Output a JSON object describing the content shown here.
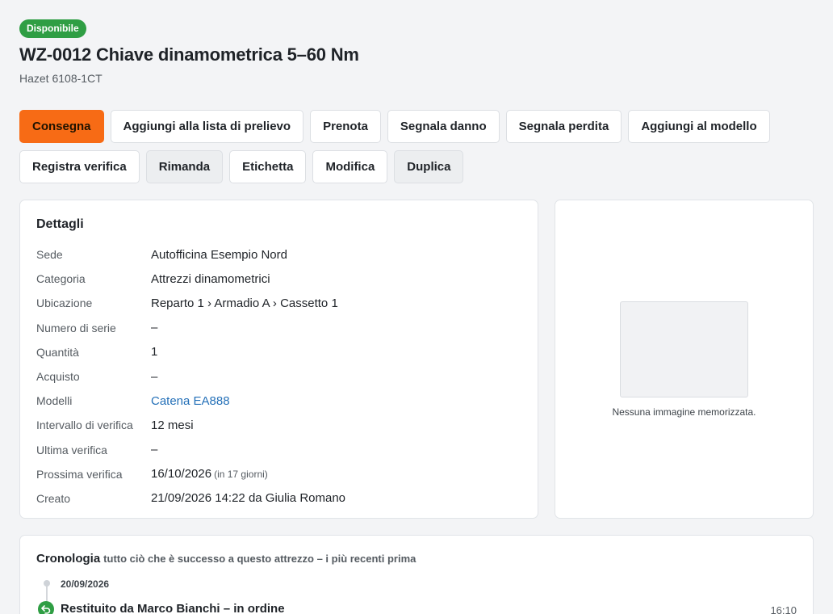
{
  "header": {
    "status_badge": "Disponibile",
    "title": "WZ-0012 Chiave dinamometrica 5–60 Nm",
    "subtitle": "Hazet 6108-1CT"
  },
  "actions": {
    "row1": [
      {
        "label": "Consegna",
        "style": "primary"
      },
      {
        "label": "Aggiungi alla lista di prelievo",
        "style": "default"
      },
      {
        "label": "Prenota",
        "style": "default"
      },
      {
        "label": "Segnala danno",
        "style": "default"
      },
      {
        "label": "Segnala perdita",
        "style": "default"
      },
      {
        "label": "Aggiungi al modello",
        "style": "default"
      }
    ],
    "row2": [
      {
        "label": "Registra verifica",
        "style": "default"
      },
      {
        "label": "Rimanda",
        "style": "muted"
      },
      {
        "label": "Etichetta",
        "style": "default"
      },
      {
        "label": "Modifica",
        "style": "default"
      },
      {
        "label": "Duplica",
        "style": "muted"
      }
    ]
  },
  "details": {
    "title": "Dettagli",
    "rows": [
      {
        "label": "Sede",
        "value": "Autofficina Esempio Nord"
      },
      {
        "label": "Categoria",
        "value": "Attrezzi dinamometrici"
      },
      {
        "label": "Ubicazione",
        "value": "Reparto 1 › Armadio A › Cassetto 1"
      },
      {
        "label": "Numero di serie",
        "value": "–"
      },
      {
        "label": "Quantità",
        "value": "1"
      },
      {
        "label": "Acquisto",
        "value": "–"
      },
      {
        "label": "Modelli",
        "value": "Catena EA888",
        "link": true
      },
      {
        "label": "Intervallo di verifica",
        "value": "12 mesi"
      },
      {
        "label": "Ultima verifica",
        "value": "–"
      },
      {
        "label": "Prossima verifica",
        "value": "16/10/2026",
        "note": "(in 17 giorni)"
      },
      {
        "label": "Creato",
        "value": "21/09/2026 14:22 da Giulia Romano"
      }
    ]
  },
  "image_panel": {
    "caption": "Nessuna immagine memorizzata."
  },
  "history": {
    "title": "Cronologia",
    "description": "tutto ciò che è successo a questo attrezzo – i più recenti prima",
    "date": "20/09/2026",
    "event": {
      "text": "Restituito da Marco Bianchi – in ordine",
      "time": "16:10",
      "icon": "return-arrow-icon"
    }
  },
  "colors": {
    "primary": "#f76b15",
    "status_green": "#2f9e44",
    "link": "#2470b8"
  }
}
